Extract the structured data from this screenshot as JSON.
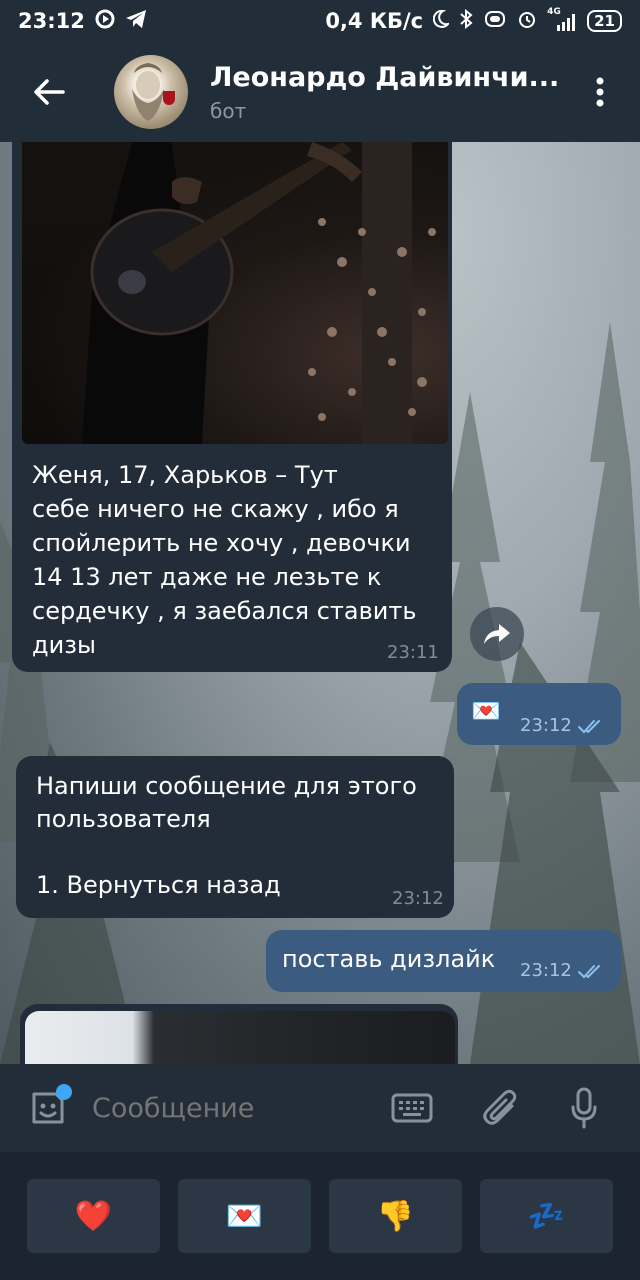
{
  "status_bar": {
    "time": "23:12",
    "net_speed": "0,4 КБ/с",
    "network": "4G",
    "battery": "21"
  },
  "header": {
    "title": "Леонардо Дайвинчи...",
    "subtitle": "бот"
  },
  "messages": [
    {
      "direction": "incoming",
      "has_photo": true,
      "text": "Женя, 17, Харьков – Тут\nсебе ничего не скажу , ибо я\nспойлерить не хочу , девочки\n14 13 лет даже не лезьте к\nсердечку , я заебался ставить\nдизы",
      "time": "23:11"
    },
    {
      "direction": "outgoing",
      "text": "💌",
      "time": "23:12",
      "read": true
    },
    {
      "direction": "incoming",
      "text": "Напиши сообщение для этого\nпользователя\n\n1. Вернуться назад",
      "time": "23:12"
    },
    {
      "direction": "outgoing",
      "text": "поставь дизлайк",
      "time": "23:12",
      "read": true
    }
  ],
  "input": {
    "placeholder": "Сообщение"
  },
  "keyboard": {
    "buttons": [
      "❤️",
      "💌",
      "👎",
      "💤"
    ]
  },
  "colors": {
    "header_bg": "#222d3a",
    "incoming_bubble": "#222d39",
    "outgoing_bubble": "#3b5b81",
    "accent": "#3ea6f2"
  }
}
